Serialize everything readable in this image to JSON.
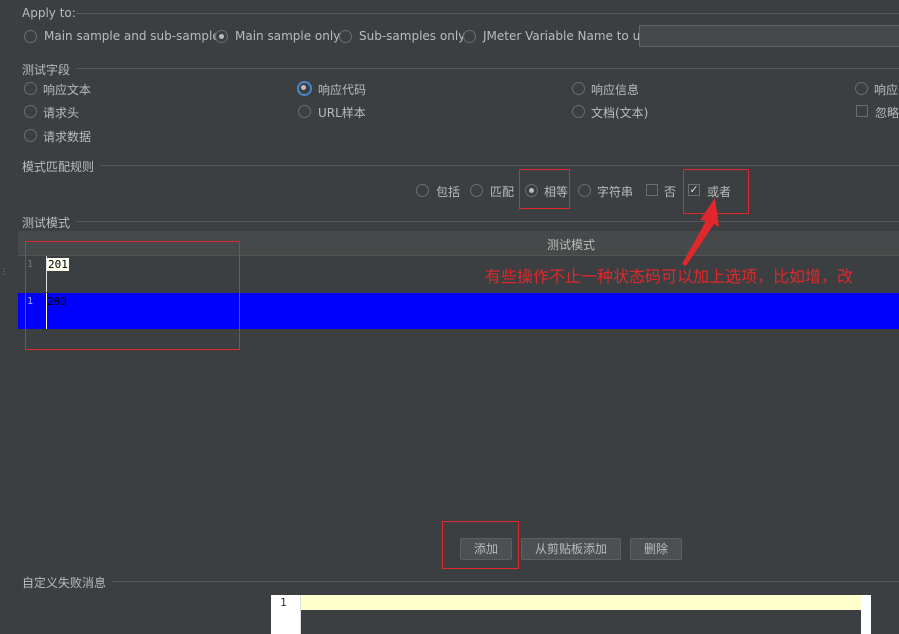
{
  "apply_to": {
    "label": "Apply to:",
    "options": [
      "Main sample and sub-samples",
      "Main sample only",
      "Sub-samples only",
      "JMeter Variable Name to use"
    ],
    "selected": "Main sample only",
    "variable_value": ""
  },
  "test_field": {
    "label": "测试字段",
    "options": [
      "响应文本",
      "响应代码",
      "响应信息",
      "响应头",
      "请求头",
      "URL样本",
      "文档(文本)",
      "忽略状态",
      "请求数据"
    ],
    "selected": "响应代码"
  },
  "pattern_rule": {
    "label": "模式匹配规则",
    "options": [
      "包括",
      "匹配",
      "相等",
      "字符串",
      "否",
      "或者"
    ],
    "selected": "相等",
    "checked": [
      "或者"
    ]
  },
  "test_pattern": {
    "label": "测试模式",
    "column_header": "测试模式",
    "rows": [
      {
        "line": "1",
        "value": "201"
      },
      {
        "line": "1",
        "value": "200"
      }
    ],
    "selected_row": 1
  },
  "annotation": {
    "text": "有些操作不止一种状态码可以加上选项，比如增，改",
    "color": "#e0272b"
  },
  "buttons": {
    "add": "添加",
    "paste": "从剪贴板添加",
    "delete": "删除"
  },
  "custom_failure": {
    "label": "自定义失败消息",
    "line": "1",
    "value": ""
  },
  "colors": {
    "background": "#3c3f41",
    "selection": "#0000ff",
    "highlight": "#e0272b",
    "editor_line": "#ffffcc"
  }
}
